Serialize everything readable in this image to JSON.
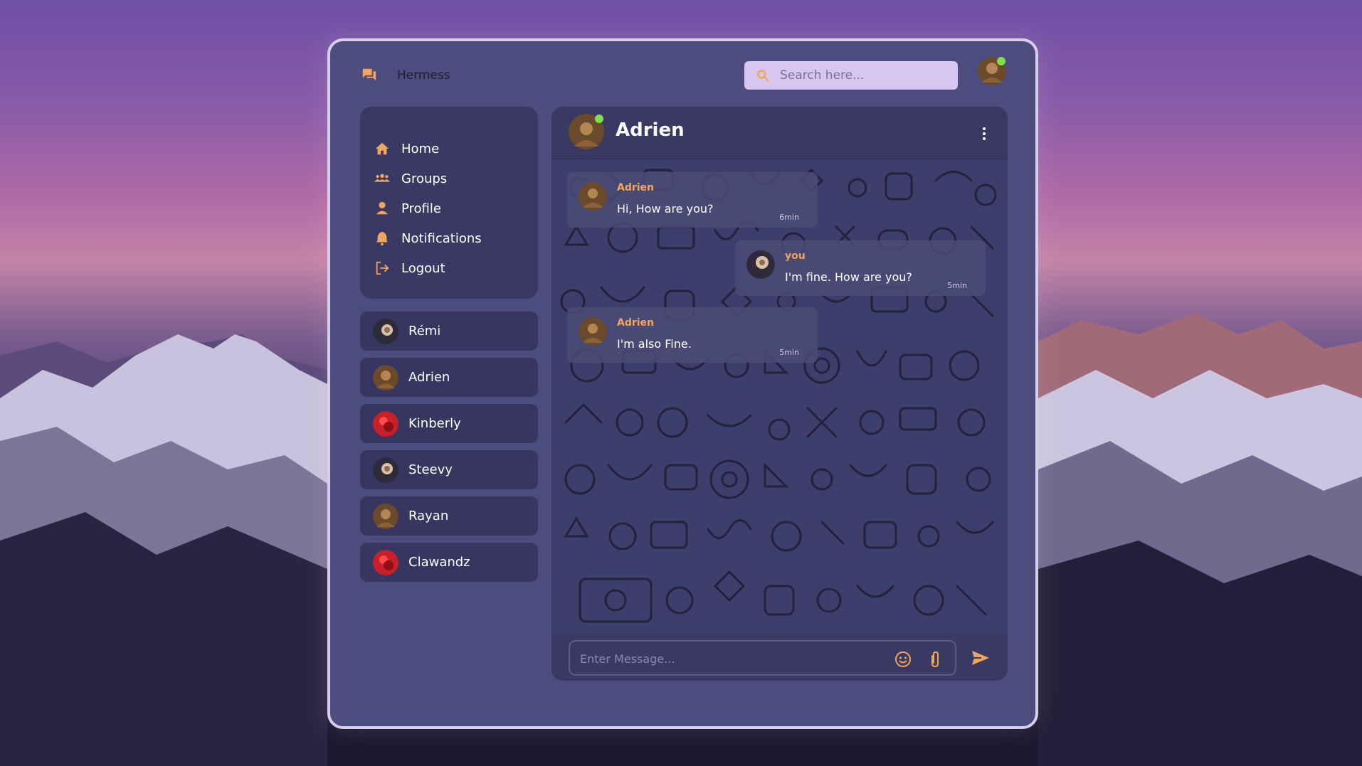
{
  "app": {
    "title": "Hermess",
    "logo_icon": "chat-bubbles-icon"
  },
  "search": {
    "placeholder": "Search here..."
  },
  "nav": {
    "items": [
      {
        "label": "Home",
        "icon": "home-icon"
      },
      {
        "label": "Groups",
        "icon": "groups-icon"
      },
      {
        "label": "Profile",
        "icon": "profile-icon"
      },
      {
        "label": "Notifications",
        "icon": "bell-icon"
      },
      {
        "label": "Logout",
        "icon": "logout-icon"
      }
    ]
  },
  "contacts": [
    {
      "name": "Rémi"
    },
    {
      "name": "Adrien"
    },
    {
      "name": "Kinberly"
    },
    {
      "name": "Steevy"
    },
    {
      "name": "Rayan"
    },
    {
      "name": "Clawandz"
    }
  ],
  "chat": {
    "contact_name": "Adrien",
    "messages": [
      {
        "author": "Adrien",
        "text": "Hi, How are you?",
        "time": "6min"
      },
      {
        "author": "you",
        "text": "I'm fine. How are you?",
        "time": "5min"
      },
      {
        "author": "Adrien",
        "text": "I'm also Fine.",
        "time": "5min"
      }
    ],
    "composer_placeholder": "Enter Message..."
  },
  "colors": {
    "accent": "#f2a55c",
    "panel": "#393963",
    "window": "#4c4c7e",
    "online": "#7fe04f"
  }
}
